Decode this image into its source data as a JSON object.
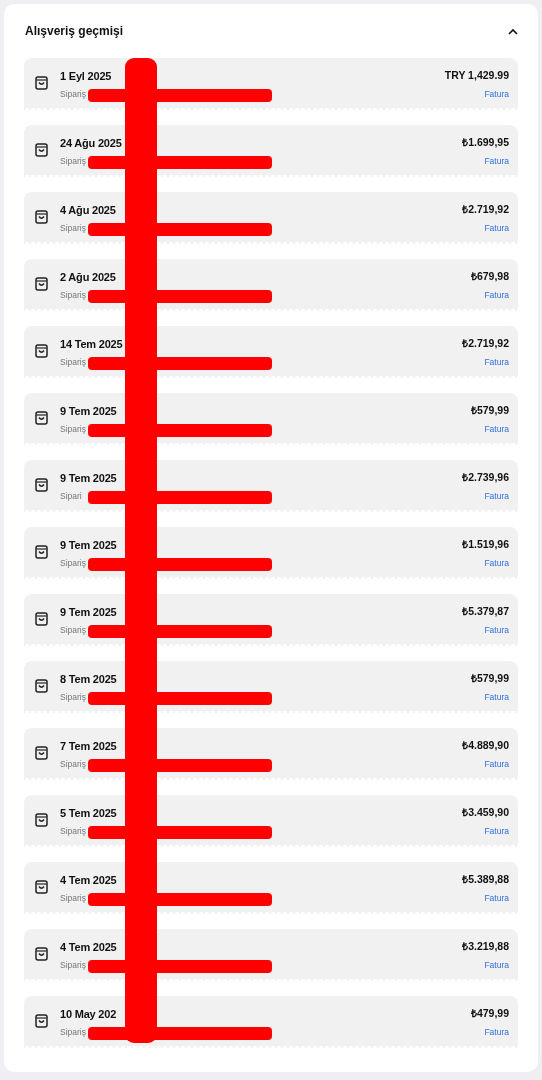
{
  "section": {
    "title": "Alışveriş geçmişi",
    "expanded": true
  },
  "orders": [
    {
      "date": "1 Eyl 2025",
      "order_label": "Sipariş",
      "price": "TRY 1,429.99",
      "invoice": "Fatura"
    },
    {
      "date": "24 Ağu 2025",
      "order_label": "Sipariş",
      "price": "₺1.699,95",
      "invoice": "Fatura"
    },
    {
      "date": "4 Ağu 2025",
      "order_label": "Sipariş",
      "price": "₺2.719,92",
      "invoice": "Fatura"
    },
    {
      "date": "2 Ağu 2025",
      "order_label": "Sipariş",
      "price": "₺679,98",
      "invoice": "Fatura"
    },
    {
      "date": "14 Tem 2025",
      "order_label": "Sipariş",
      "price": "₺2.719,92",
      "invoice": "Fatura"
    },
    {
      "date": "9 Tem 2025",
      "order_label": "Sipariş",
      "price": "₺579,99",
      "invoice": "Fatura"
    },
    {
      "date": "9 Tem 2025",
      "order_label": "Sipari",
      "price": "₺2.739,96",
      "invoice": "Fatura"
    },
    {
      "date": "9 Tem 2025",
      "order_label": "Sipariş",
      "price": "₺1.519,96",
      "invoice": "Fatura"
    },
    {
      "date": "9 Tem 2025",
      "order_label": "Sipariş",
      "price": "₺5.379,87",
      "invoice": "Fatura"
    },
    {
      "date": "8 Tem 2025",
      "order_label": "Sipariş",
      "price": "₺579,99",
      "invoice": "Fatura"
    },
    {
      "date": "7 Tem 2025",
      "order_label": "Sipariş",
      "price": "₺4.889,90",
      "invoice": "Fatura"
    },
    {
      "date": "5 Tem 2025",
      "order_label": "Sipariş",
      "price": "₺3.459,90",
      "invoice": "Fatura"
    },
    {
      "date": "4 Tem 2025",
      "order_label": "Sipariş",
      "price": "₺5.389,88",
      "invoice": "Fatura"
    },
    {
      "date": "4 Tem 2025",
      "order_label": "Sipariş",
      "price": "₺3.219,88",
      "invoice": "Fatura"
    },
    {
      "date": "10 May 202",
      "order_label": "Sipariş",
      "price": "₺479,99",
      "invoice": "Fatura"
    }
  ]
}
